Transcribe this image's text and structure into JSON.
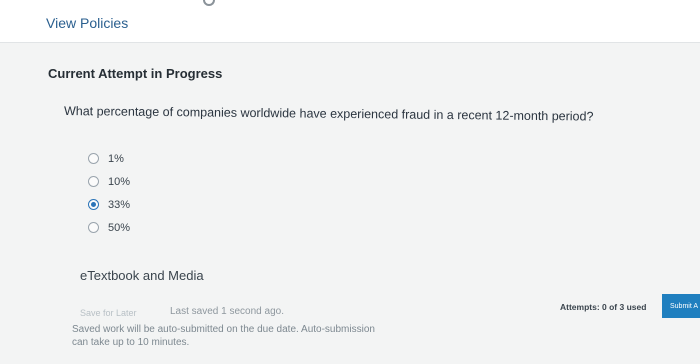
{
  "header": {
    "policies_link": "View Policies"
  },
  "attempt": {
    "status_title": "Current Attempt in Progress"
  },
  "question": {
    "text": "What percentage of companies worldwide have experienced fraud in a recent 12-month period?",
    "options": [
      {
        "label": "1%",
        "selected": false
      },
      {
        "label": "10%",
        "selected": false
      },
      {
        "label": "33%",
        "selected": true
      },
      {
        "label": "50%",
        "selected": false
      }
    ]
  },
  "resources": {
    "etextbook_label": "eTextbook and Media"
  },
  "footer": {
    "save_later_label": "Save for Later",
    "last_saved": "Last saved 1 second ago.",
    "auto_submit_note": "Saved work will be auto-submitted on the due date. Auto-submission can take up to 10 minutes.",
    "attempts": "Attempts: 0 of 3 used",
    "submit_label": "Submit A"
  }
}
